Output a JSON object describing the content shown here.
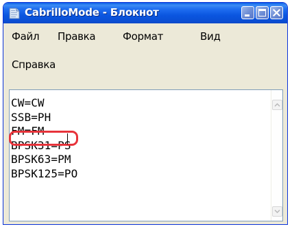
{
  "window": {
    "title": "CabrilloMode - Блокнот"
  },
  "icons": {
    "app": "notepad-icon",
    "minimize": "minimize-icon",
    "maximize": "maximize-icon",
    "close": "close-icon",
    "scroll_up": "arrow-up-icon",
    "scroll_down": "arrow-down-icon"
  },
  "menu": {
    "file": "Файл",
    "edit": "Правка",
    "format": "Формат",
    "view": "Вид",
    "help": "Справка"
  },
  "editor": {
    "lines": [
      "CW=CW",
      "SSB=PH",
      "FM=FM",
      "BPSK31=PS",
      "BPSK63=PM",
      "BPSK125=PO"
    ],
    "highlighted_line": "FM=FM",
    "highlight_color": "#e7333a"
  },
  "colors": {
    "titlebar": "#0b56e0",
    "window_bg": "#ece9d8"
  }
}
